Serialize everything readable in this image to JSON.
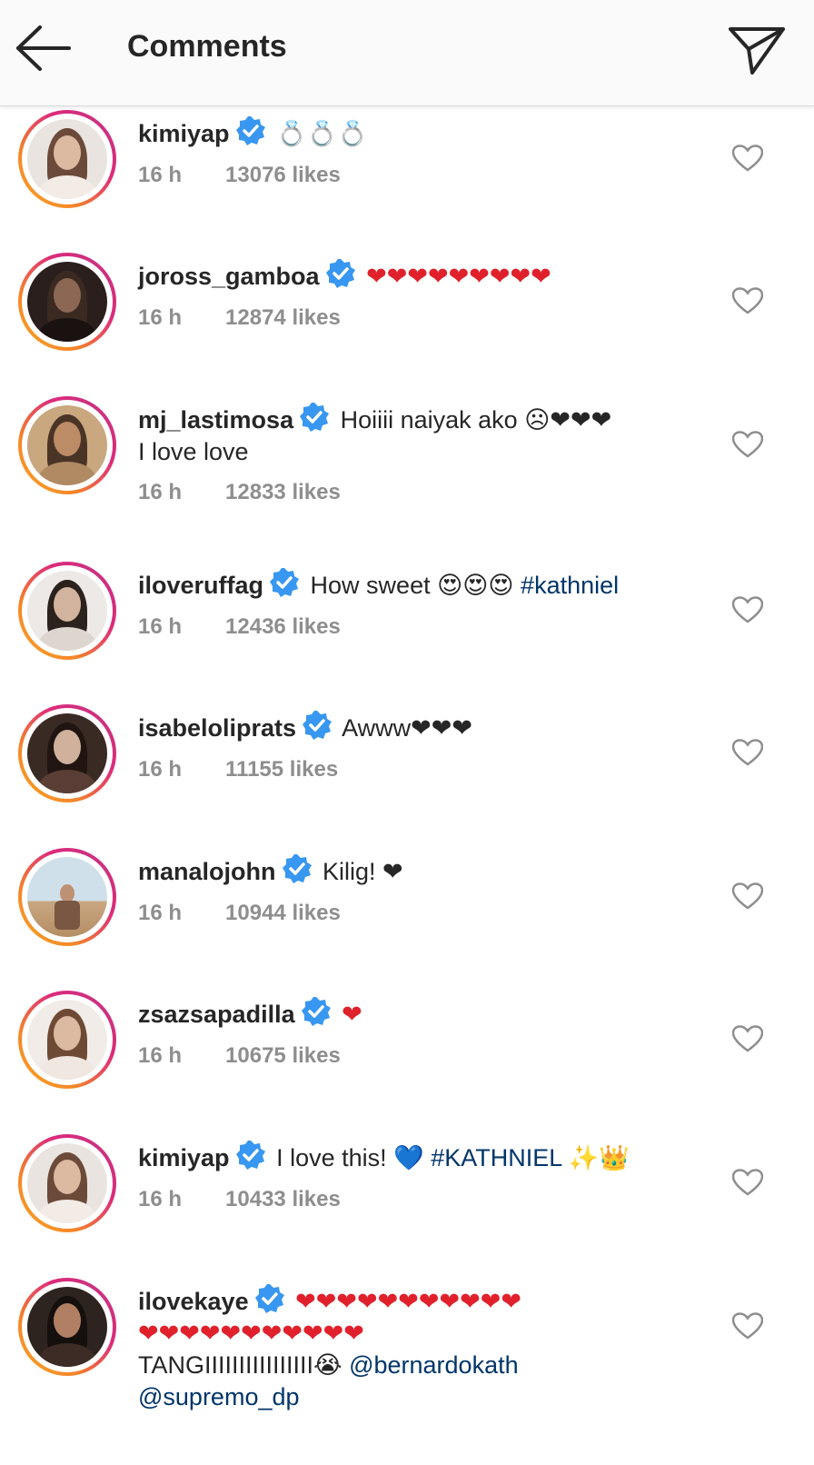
{
  "header": {
    "title": "Comments",
    "back_icon": "arrow-left-icon",
    "share_icon": "paper-plane-icon"
  },
  "colors": {
    "verified": "#3897f0",
    "link": "#003569",
    "meta": "#8e8e8e",
    "heart_emoji": "#e0212c"
  },
  "comments": [
    {
      "username": "kimiyap",
      "text": "💍💍💍",
      "hashtags": "",
      "suffix": "",
      "time": "16 h",
      "likes": "13076 likes",
      "avatar_style": "light"
    },
    {
      "username": "joross_gamboa",
      "text": "❤❤❤❤❤❤❤❤❤",
      "hashtags": "",
      "suffix": "",
      "time": "16 h",
      "likes": "12874 likes",
      "avatar_style": "dark"
    },
    {
      "username": "mj_lastimosa",
      "text": "Hoiiii naiyak ako ☹❤❤❤",
      "line2": "I love love",
      "time": "16 h",
      "likes": "12833 likes",
      "avatar_style": "beach"
    },
    {
      "username": "iloveruffag",
      "text": "How sweet 😍😍😍 ",
      "hashtags": "#kathniel",
      "time": "16 h",
      "likes": "12436 likes",
      "avatar_style": "light"
    },
    {
      "username": "isabeloliprats",
      "text": "Awww❤❤❤",
      "time": "16 h",
      "likes": "11155 likes",
      "avatar_style": "darkhair"
    },
    {
      "username": "manalojohn",
      "text": "Kilig! ❤",
      "time": "16 h",
      "likes": "10944 likes",
      "avatar_style": "outdoor"
    },
    {
      "username": "zsazsapadilla",
      "text": "❤",
      "time": "16 h",
      "likes": "10675 likes",
      "avatar_style": "light"
    },
    {
      "username": "kimiyap",
      "text": "I love this! 💙 ",
      "hashtags": "#KATHNIEL",
      "suffix": " ✨👑",
      "time": "16 h",
      "likes": "10433 likes",
      "avatar_style": "light"
    },
    {
      "username": "ilovekaye",
      "text": "❤❤❤❤❤❤❤❤❤❤❤",
      "line2": "❤❤❤❤❤❤❤❤❤❤❤",
      "line3_text": "TANGIIIIIIIIIIIIIIII😭 ",
      "line3_mention": "@bernardokath",
      "line4_mention": "@supremo_dp",
      "avatar_style": "darkhair"
    }
  ]
}
